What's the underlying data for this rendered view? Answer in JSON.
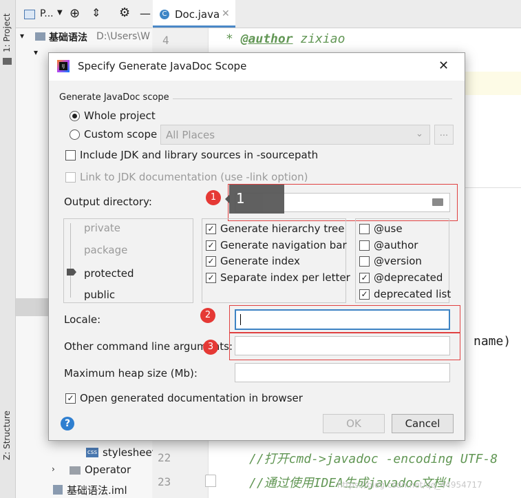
{
  "ide": {
    "side_tab_project": "1: Project",
    "side_tab_structure": "Z: Structure",
    "panel_title": "P...",
    "tab_file": "Doc.java",
    "tab_file_icon": "C",
    "tree_root": "基础语法",
    "tree_root_path": "D:\\Users\\W",
    "tree_stylesheet": "stylesheet",
    "tree_stylesheet_icon": "css",
    "tree_operator": "Operator",
    "tree_iml": "基础语法.iml",
    "line_4": "4",
    "line_22": "22",
    "line_23": "23",
    "code_line_4_prefix": "* ",
    "code_line_4_tag": "@author",
    "code_line_4_rest": " zixiao",
    "code_peek": "name)",
    "code_line_22": "//打开cmd->javadoc -encoding UTF-8",
    "code_line_23": "//通过使用IDEA生成javadoc文档!"
  },
  "dialog": {
    "title": "Specify Generate JavaDoc Scope",
    "scope_group_label": "Generate JavaDoc scope",
    "whole_project_label": "Whole project",
    "custom_scope_label": "Custom scope",
    "custom_scope_value": "All Places",
    "ellipsis_button": "...",
    "include_jdk_label": "Include JDK and library sources in -sourcepath",
    "link_jdk_label": "Link to JDK documentation (use -link option)",
    "output_dir_label": "Output directory:",
    "output_dir_value": "",
    "visibility_levels": [
      "private",
      "package",
      "protected",
      "public"
    ],
    "selected_visibility": "protected",
    "gen_options": [
      {
        "label": "Generate hierarchy tree",
        "checked": true
      },
      {
        "label": "Generate navigation bar",
        "checked": true
      },
      {
        "label": "Generate index",
        "checked": true
      },
      {
        "label": "Separate index per letter",
        "checked": true
      }
    ],
    "tag_options": [
      {
        "label": "@use",
        "checked": false
      },
      {
        "label": "@author",
        "checked": false
      },
      {
        "label": "@version",
        "checked": false
      },
      {
        "label": "@deprecated",
        "checked": true
      },
      {
        "label": "deprecated list",
        "checked": true
      }
    ],
    "locale_label": "Locale:",
    "locale_value": "",
    "other_args_label": "Other command line arguments:",
    "other_args_value": "",
    "heap_label": "Maximum heap size (Mb):",
    "heap_value": "",
    "open_browser_label": "Open generated documentation in browser",
    "ok_label": "OK",
    "cancel_label": "Cancel",
    "help_label": "?"
  },
  "annotations": {
    "badge_1": "1",
    "badge_2": "2",
    "badge_3": "3",
    "tooltip_1": "1",
    "accent_color": "#e53935"
  },
  "watermark": "https://blog.csdn.net/qq_44954717"
}
